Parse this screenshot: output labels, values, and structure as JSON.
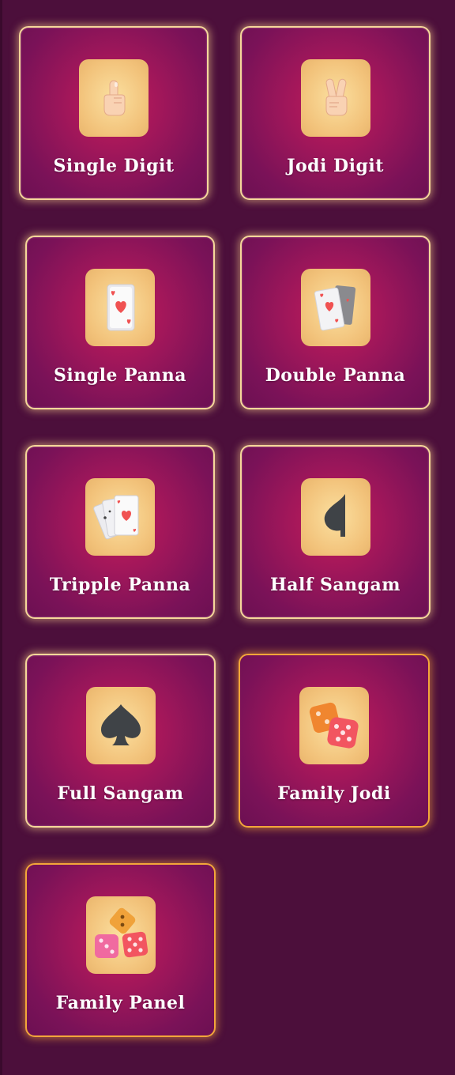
{
  "games": [
    {
      "label": "Single Digit",
      "icon": "index-finger-icon"
    },
    {
      "label": "Jodi Digit",
      "icon": "victory-hand-icon"
    },
    {
      "label": "Single Panna",
      "icon": "playing-card-icon"
    },
    {
      "label": "Double Panna",
      "icon": "two-cards-icon"
    },
    {
      "label": "Tripple Panna",
      "icon": "three-cards-icon"
    },
    {
      "label": "Half Sangam",
      "icon": "half-spade-icon"
    },
    {
      "label": "Full Sangam",
      "icon": "spade-icon"
    },
    {
      "label": "Family Jodi",
      "icon": "two-dice-icon"
    },
    {
      "label": "Family Panel",
      "icon": "three-dice-icon"
    }
  ],
  "colors": {
    "background": "#4c0f3b",
    "card_border": "#f6d79a",
    "card_border_highlight": "#f3a63a",
    "tile": "#f2c27a",
    "label": "#ffffff"
  }
}
